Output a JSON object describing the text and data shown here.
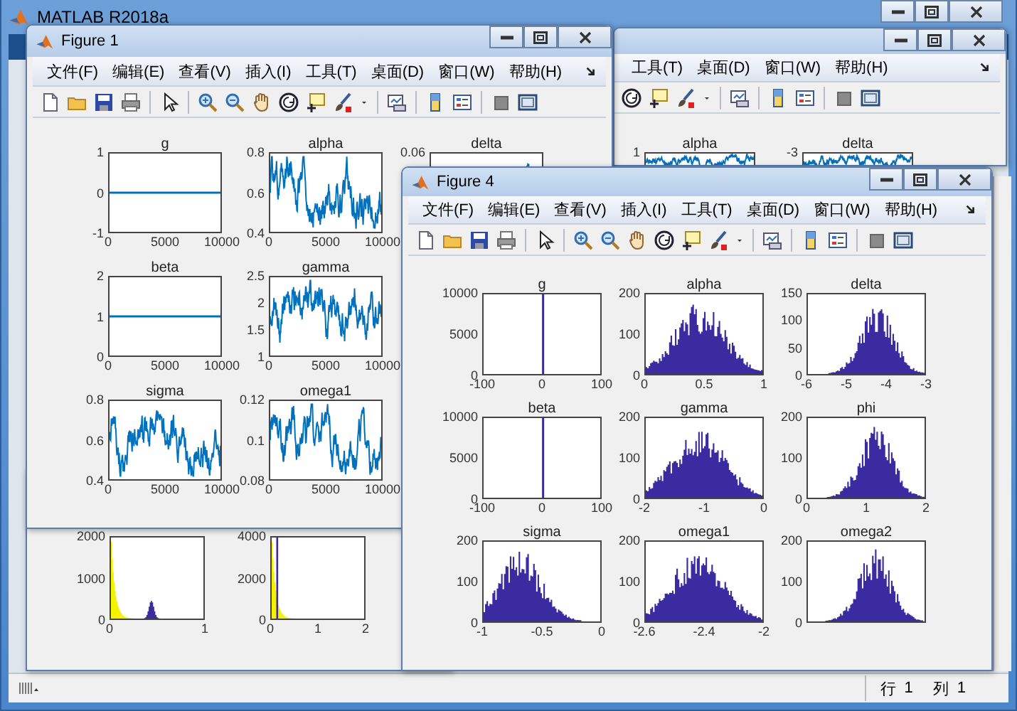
{
  "main_window": {
    "title": "MATLAB R2018a"
  },
  "windows": [
    {
      "kind": "figure",
      "title": "Figure 1",
      "menu": [
        "文件(F)",
        "编辑(E)",
        "查看(V)",
        "插入(I)",
        "工具(T)",
        "桌面(D)",
        "窗口(W)",
        "帮助(H)"
      ],
      "rows": [
        [
          {
            "title": "g",
            "kind": "flat",
            "yticks": [
              "1",
              "0",
              "-1"
            ],
            "xticks": [
              "0",
              "5000",
              "10000"
            ]
          },
          {
            "title": "alpha",
            "kind": "trace",
            "yticks": [
              "0.8",
              "0.6",
              "0.4"
            ],
            "xticks": [
              "0",
              "5000",
              "10000"
            ]
          },
          {
            "title": "delta",
            "kind": "trace",
            "yticks": [
              "0.06"
            ]
          }
        ],
        [
          {
            "title": "beta",
            "kind": "flat",
            "yticks": [
              "2",
              "1",
              "0"
            ],
            "xticks": [
              "0",
              "5000",
              "10000"
            ]
          },
          {
            "title": "gamma",
            "kind": "trace",
            "yticks": [
              "2.5",
              "2",
              "1.5",
              "1"
            ],
            "xticks": [
              "0",
              "5000",
              "10000"
            ]
          }
        ],
        [
          {
            "title": "sigma",
            "kind": "trace",
            "yticks": [
              "0.8",
              "0.6",
              "0.4"
            ],
            "xticks": [
              "0",
              "5000",
              "10000"
            ]
          },
          {
            "title": "omega1",
            "kind": "trace",
            "yticks": [
              "0.12",
              "0.1",
              "0.08"
            ],
            "xticks": [
              "0",
              "5000",
              "10000"
            ]
          }
        ]
      ]
    },
    {
      "kind": "clipped_figure",
      "menu": [
        "工具(T)",
        "桌面(D)",
        "窗口(W)",
        "帮助(H)"
      ],
      "rows": [
        [
          {
            "title": "alpha",
            "kind": "trace",
            "yticks": [
              "1"
            ]
          },
          {
            "title": "delta",
            "kind": "trace",
            "yticks": [
              "-3"
            ]
          }
        ]
      ]
    },
    {
      "kind": "fragment",
      "rows": [
        [
          {
            "kind": "dual_hist",
            "yticks": [
              "2000",
              "1000",
              "0"
            ],
            "xticks": [
              "0",
              "1"
            ]
          },
          {
            "kind": "dual_hist",
            "yticks": [
              "4000",
              "2000",
              "0"
            ],
            "xticks": [
              "0",
              "1",
              "2"
            ]
          }
        ]
      ]
    },
    {
      "kind": "figure",
      "title": "Figure 4",
      "menu": [
        "文件(F)",
        "编辑(E)",
        "查看(V)",
        "插入(I)",
        "工具(T)",
        "桌面(D)",
        "窗口(W)",
        "帮助(H)"
      ],
      "rows": [
        [
          {
            "title": "g",
            "kind": "spike",
            "yticks": [
              "10000",
              "5000",
              "0"
            ],
            "xticks": [
              "-100",
              "0",
              "100"
            ]
          },
          {
            "title": "alpha",
            "kind": "hist",
            "yticks": [
              "200",
              "100",
              "0"
            ],
            "xticks": [
              "0",
              "0.5",
              "1"
            ]
          },
          {
            "title": "delta",
            "kind": "hist",
            "yticks": [
              "150",
              "100",
              "50",
              "0"
            ],
            "xticks": [
              "-6",
              "-5",
              "-4",
              "-3"
            ]
          }
        ],
        [
          {
            "title": "beta",
            "kind": "spike",
            "yticks": [
              "10000",
              "5000",
              "0"
            ],
            "xticks": [
              "-100",
              "0",
              "100"
            ]
          },
          {
            "title": "gamma",
            "kind": "hist",
            "yticks": [
              "200",
              "100",
              "0"
            ],
            "xticks": [
              "-2",
              "-1",
              "0"
            ]
          },
          {
            "title": "phi",
            "kind": "hist",
            "yticks": [
              "200",
              "100",
              "0"
            ],
            "xticks": [
              "0",
              "1",
              "2"
            ]
          }
        ],
        [
          {
            "title": "sigma",
            "kind": "hist",
            "yticks": [
              "200",
              "100",
              "0"
            ],
            "xticks": [
              "-1",
              "-0.5",
              "0"
            ]
          },
          {
            "title": "omega1",
            "kind": "hist",
            "yticks": [
              "200",
              "100",
              "0"
            ],
            "xticks": [
              "-2.6",
              "-2.4",
              "-2"
            ]
          },
          {
            "title": "omega2",
            "kind": "hist",
            "yticks": [
              "200",
              "100",
              "0"
            ]
          }
        ]
      ]
    }
  ],
  "status_bar": {
    "row_label": "行",
    "row_value": "1",
    "col_label": "列",
    "col_value": "1"
  }
}
